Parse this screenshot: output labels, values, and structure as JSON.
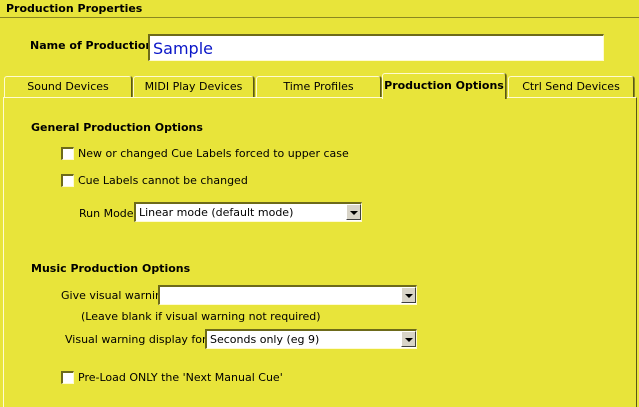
{
  "window": {
    "title": "Production Properties"
  },
  "production": {
    "name_label": "Name of Production",
    "name_value": "Sample"
  },
  "tabs": [
    {
      "label": "Sound Devices"
    },
    {
      "label": "MIDI Play Devices"
    },
    {
      "label": "Time Profiles"
    },
    {
      "label": "Production Options",
      "active": true
    },
    {
      "label": "Ctrl Send Devices"
    }
  ],
  "general": {
    "title": "General Production Options",
    "uppercase_label": "New or changed Cue Labels forced to upper case",
    "uppercase_checked": false,
    "cannot_change_label": "Cue Labels cannot be changed",
    "cannot_change_checked": false,
    "run_mode_label": "Run Mode",
    "run_mode_value": "Linear mode (default mode)"
  },
  "music": {
    "title": "Music Production Options",
    "visual_warning_label": "Give visual warning",
    "visual_warning_value": "",
    "visual_warning_hint": "(Leave blank if visual warning not required)",
    "display_format_label": "Visual warning display format",
    "display_format_value": "Seconds only (eg 9)",
    "preload_label": "Pre-Load ONLY the 'Next Manual Cue'",
    "preload_checked": false
  }
}
